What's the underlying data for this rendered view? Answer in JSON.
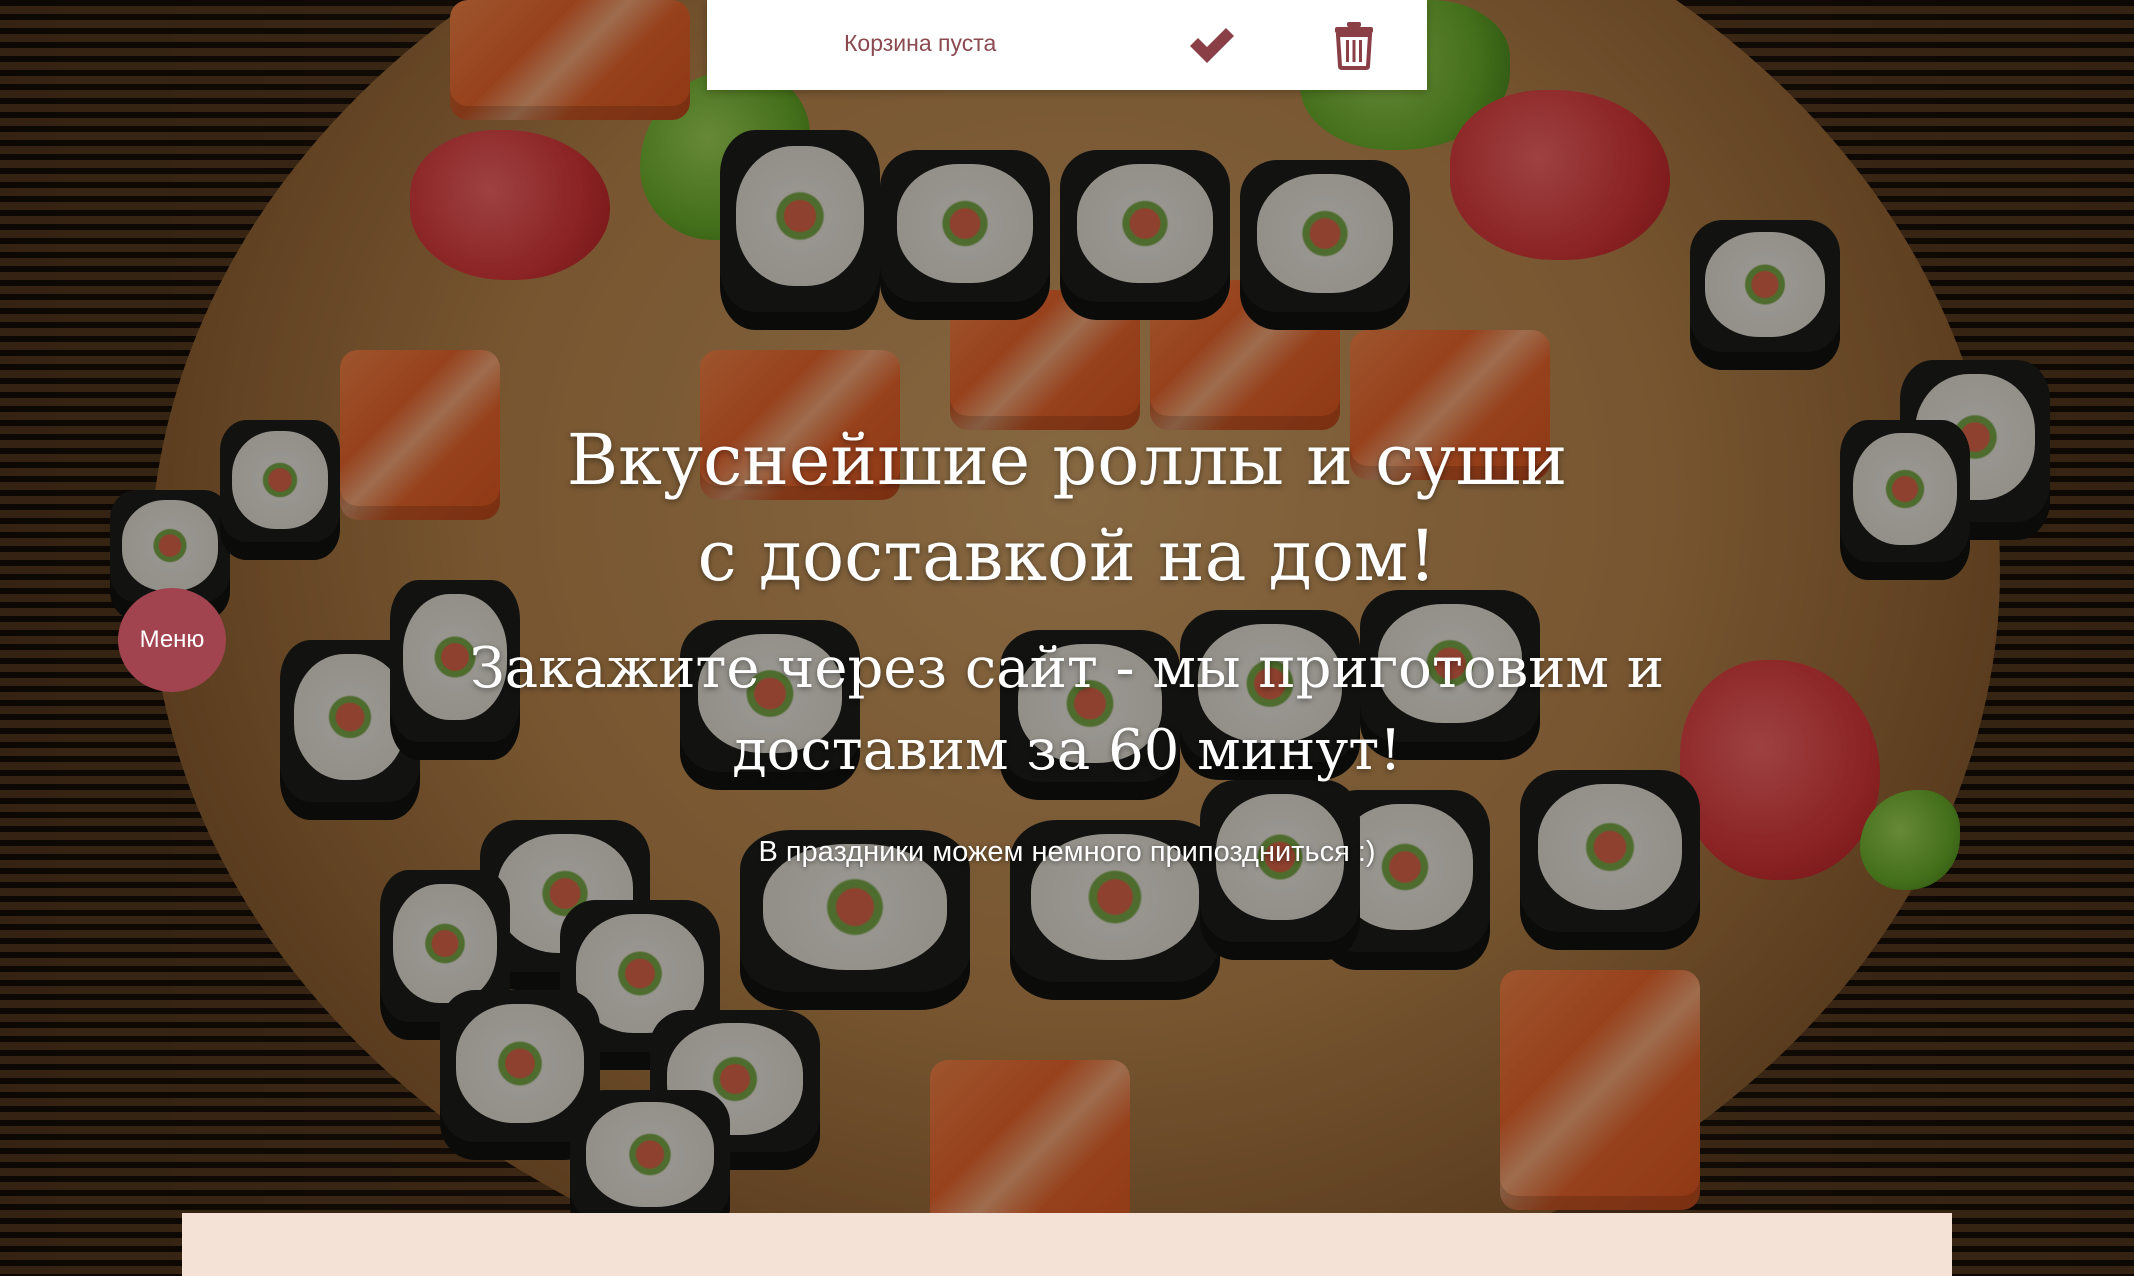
{
  "cart": {
    "status_text": "Корзина пуста",
    "confirm_icon": "checkmark-icon",
    "clear_icon": "trash-icon",
    "accent_color": "#8a3f47"
  },
  "hero": {
    "title_line1": "Вкуснейшие роллы и суши",
    "title_line2": "с доставкой на дом!",
    "subtitle_line1": "Закажите через сайт - мы приготовим и",
    "subtitle_line2": "доставим за 60 минут!",
    "note": "В праздники можем немного припоздниться :)"
  },
  "menu_button": {
    "label": "Меню",
    "color": "#a1444f"
  },
  "content_panel": {
    "color": "#f3e2d5"
  }
}
